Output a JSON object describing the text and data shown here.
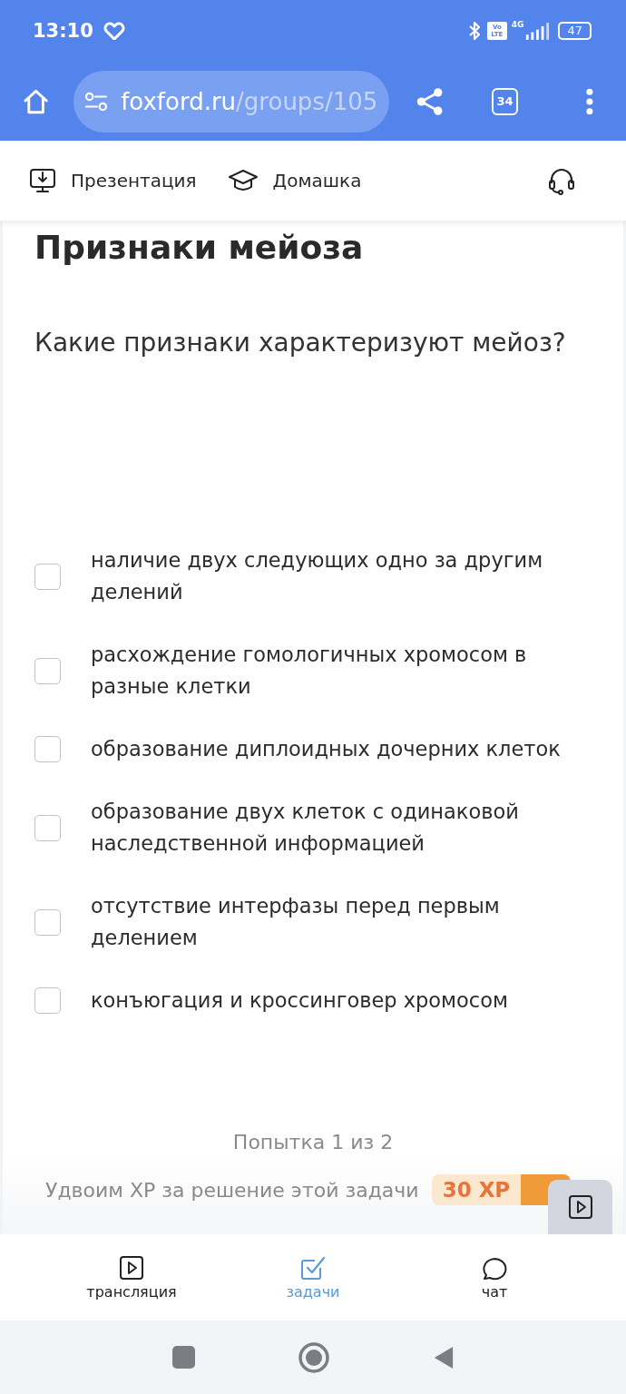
{
  "status_bar": {
    "time": "13:10",
    "volte": "Vo LTE",
    "network": "4G",
    "battery": "47"
  },
  "browser": {
    "url_host": "foxford.ru",
    "url_path": "/groups/105",
    "tab_count": "34"
  },
  "lesson_toolbar": [
    {
      "kind": "presentation",
      "label": "Презентация"
    },
    {
      "kind": "homework",
      "label": "Домашка"
    }
  ],
  "task": {
    "title": "Признаки мейоза",
    "question": "Какие признаки характеризуют мейоз?",
    "options": [
      {
        "text": "наличие двух следующих одно за другим делений",
        "checked": false
      },
      {
        "text": "расхождение гомологичных хромосом в разные клетки",
        "checked": false
      },
      {
        "text": "образование диплоидных дочерних клеток",
        "checked": false
      },
      {
        "text": "образование двух клеток с одинаковой наследственной информацией",
        "checked": false
      },
      {
        "text": "отсутствие интерфазы перед первым делением",
        "checked": false
      },
      {
        "text": "конъюгация и кроссинговер хромосом",
        "checked": false
      }
    ],
    "attempt": "Попытка 1 из 2",
    "bonus_text": "Удвоим XP за решение этой задачи",
    "xp_badge": "30 XP"
  },
  "bottom_nav": [
    {
      "kind": "stream",
      "label": "трансляция",
      "selected": false
    },
    {
      "kind": "tasks",
      "label": "задачи",
      "selected": true
    },
    {
      "kind": "chat",
      "label": "чат",
      "selected": false
    }
  ]
}
